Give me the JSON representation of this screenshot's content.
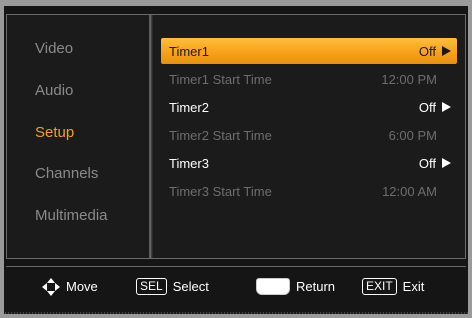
{
  "menu": {
    "items": [
      {
        "label": "Video",
        "active": false
      },
      {
        "label": "Audio",
        "active": false
      },
      {
        "label": "Setup",
        "active": true
      },
      {
        "label": "Channels",
        "active": false
      },
      {
        "label": "Multimedia",
        "active": false
      }
    ]
  },
  "settings": {
    "rows": [
      {
        "label": "Timer1",
        "value": "Off",
        "state": "selected",
        "has_arrow": true
      },
      {
        "label": "Timer1 Start Time",
        "value": "12:00 PM",
        "state": "disabled",
        "has_arrow": false
      },
      {
        "label": "Timer2",
        "value": "Off",
        "state": "enabled",
        "has_arrow": true
      },
      {
        "label": "Timer2 Start Time",
        "value": "6:00 PM",
        "state": "disabled",
        "has_arrow": false
      },
      {
        "label": "Timer3",
        "value": "Off",
        "state": "enabled",
        "has_arrow": true
      },
      {
        "label": "Timer3 Start Time",
        "value": "12:00 AM",
        "state": "disabled",
        "has_arrow": false
      }
    ]
  },
  "footer": {
    "move_label": "Move",
    "select_key": "SEL",
    "select_label": "Select",
    "return_label": "Return",
    "exit_key": "EXIT",
    "exit_label": "Exit"
  },
  "colors": {
    "accent": "#f7a219",
    "active_menu_text": "#f4a020",
    "inactive_text": "#8a8a8a",
    "disabled_text": "#6d6d6d",
    "background": "#1b1b1b"
  },
  "icons": {
    "move": "four-way-arrow-icon",
    "select": "sel-key-icon",
    "return": "return-key-icon",
    "exit": "exit-key-icon",
    "value_arrow": "right-triangle-icon"
  }
}
